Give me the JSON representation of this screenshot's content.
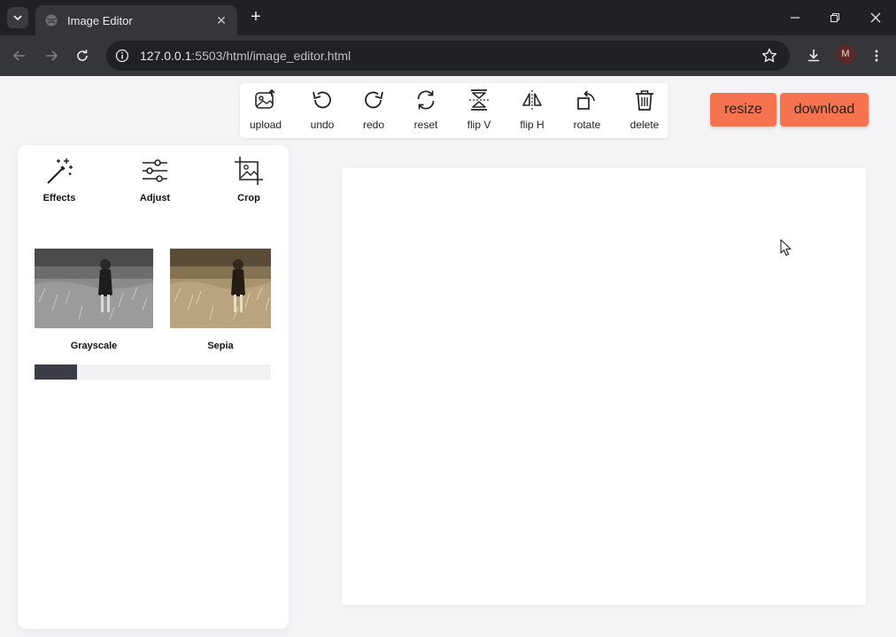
{
  "browser": {
    "tab_title": "Image Editor",
    "url_host": "127.0.0.1",
    "url_path": ":5503/html/image_editor.html",
    "profile_initial": "M"
  },
  "toolbar": {
    "tools": [
      {
        "label": "upload",
        "icon": "upload-image-icon"
      },
      {
        "label": "undo",
        "icon": "undo-icon"
      },
      {
        "label": "redo",
        "icon": "redo-icon"
      },
      {
        "label": "reset",
        "icon": "reset-icon"
      },
      {
        "label": "flip V",
        "icon": "flip-vertical-icon"
      },
      {
        "label": "flip H",
        "icon": "flip-horizontal-icon"
      },
      {
        "label": "rotate",
        "icon": "rotate-icon"
      },
      {
        "label": "delete",
        "icon": "trash-icon"
      }
    ]
  },
  "actions": {
    "resize_label": "resize",
    "download_label": "download"
  },
  "panel": {
    "tabs": [
      {
        "label": "Effects",
        "icon": "magic-wand-icon"
      },
      {
        "label": "Adjust",
        "icon": "sliders-icon"
      },
      {
        "label": "Crop",
        "icon": "crop-icon"
      }
    ],
    "effects": [
      {
        "label": "Grayscale"
      },
      {
        "label": "Sepia"
      }
    ],
    "slider_fraction": 0.18
  },
  "colors": {
    "accent": "#f5734e",
    "slider_fill": "#3c3c44"
  }
}
